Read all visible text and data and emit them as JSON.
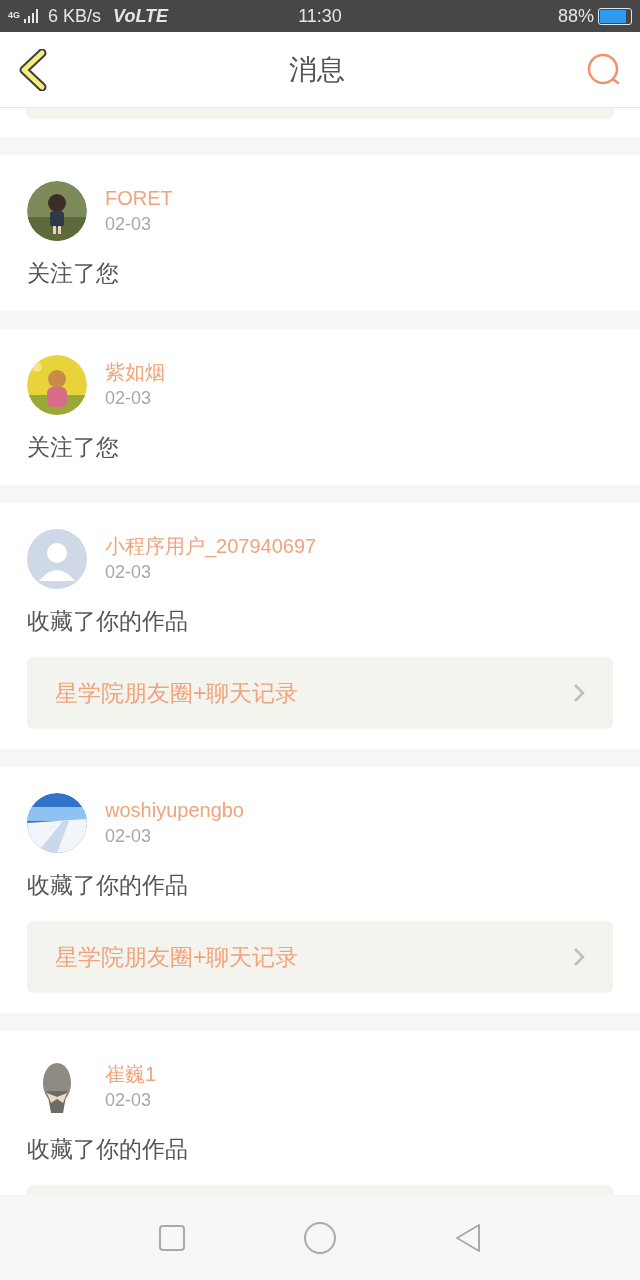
{
  "status_bar": {
    "network": "4G",
    "speed": "6 KB/s",
    "volte": "VoLTE",
    "time": "11:30",
    "battery": "88%"
  },
  "header": {
    "title": "消息"
  },
  "top_partial_card": true,
  "messages": [
    {
      "kind": "follow",
      "user": "FORET",
      "date": "02-03",
      "action": "关注了您"
    },
    {
      "kind": "follow",
      "user": "紫如烟",
      "date": "02-03",
      "action": "关注了您"
    },
    {
      "kind": "collect",
      "user": "小程序用户_207940697",
      "date": "02-03",
      "avatar": {
        "kind": "default"
      },
      "action": "收藏了你的作品",
      "link": "星学院朋友圈+聊天记录"
    },
    {
      "kind": "collect",
      "user": "woshiyupengbo",
      "date": "02-03",
      "action": "收藏了你的作品",
      "link": "星学院朋友圈+聊天记录"
    },
    {
      "kind": "collect",
      "user": "崔巍1",
      "date": "02-03",
      "action": "收藏了你的作品"
    }
  ]
}
